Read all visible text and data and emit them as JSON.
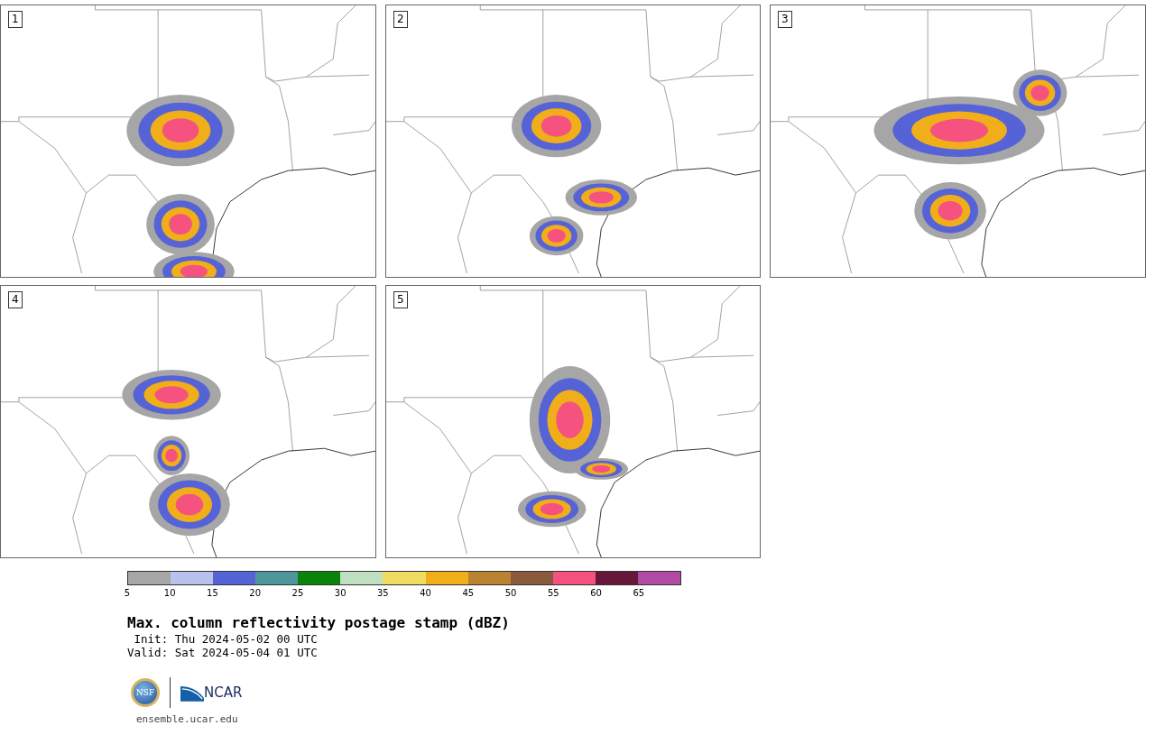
{
  "panels": [
    {
      "label": "1"
    },
    {
      "label": "2"
    },
    {
      "label": "3"
    },
    {
      "label": "4"
    },
    {
      "label": "5"
    }
  ],
  "colorbar": {
    "bins": [
      {
        "color": "#a6a6a6"
      },
      {
        "color": "#b8c2ed"
      },
      {
        "color": "#5663d6"
      },
      {
        "color": "#4f969c"
      },
      {
        "color": "#0a830a"
      },
      {
        "color": "#c0dfc0"
      },
      {
        "color": "#f0dc60"
      },
      {
        "color": "#f0ae1a"
      },
      {
        "color": "#b98332"
      },
      {
        "color": "#8a5a3e"
      },
      {
        "color": "#f55280"
      },
      {
        "color": "#66183a"
      },
      {
        "color": "#b04aa4"
      }
    ],
    "ticks": [
      "5",
      "10",
      "15",
      "20",
      "25",
      "30",
      "35",
      "40",
      "45",
      "50",
      "55",
      "60",
      "65"
    ]
  },
  "title": "Max. column reflectivity postage stamp (dBZ)",
  "init": " Init: Thu 2024-05-02 00 UTC",
  "valid": "Valid: Sat 2024-05-04 01 UTC",
  "logo": {
    "left": "NSF",
    "right": "NCAR"
  },
  "footer": "ensemble.ucar.edu"
}
